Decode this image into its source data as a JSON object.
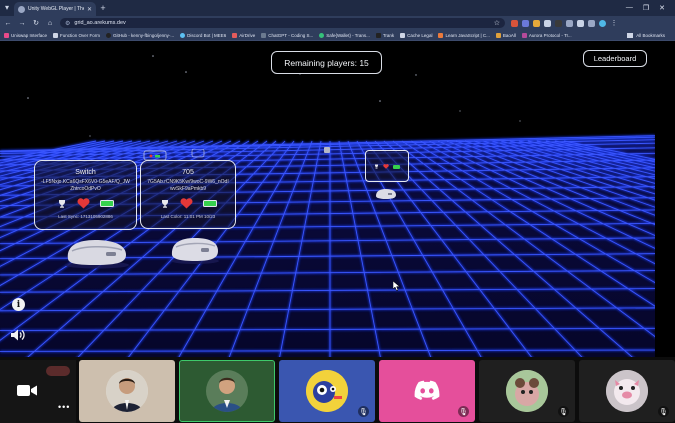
{
  "browser": {
    "tab_title": "Unity WebGL Player | The Li...",
    "url": "grid_ao.arekums.dev",
    "bookmarks": [
      "Uniswap Interface",
      "Function Over Form",
      "GitHub - kenny-fbingo/jenny-...",
      "Discord Bot | MEE6",
      "AirDrive",
      "ChatGPT - Coding S...",
      "Safe{Wallet} - Trans...",
      "Trank",
      "Cache Legal",
      "Learn JavaScript | C...",
      "BaoAll",
      "Aurora Protocol - Tr..."
    ],
    "all_bookmarks": "All Bookmarks"
  },
  "game": {
    "remaining_label": "Remaining players: 15",
    "leaderboard_label": "Leaderboard",
    "info_label": "i",
    "players": [
      {
        "name": "Switch",
        "address": "-LF5Nxjo.KCa6QsFX6V0-G5eAF/Q_JWZhtrcoOdPvO",
        "footer": "Last Sync: 1713105902886"
      },
      {
        "name": "705",
        "address": "7G5Ab.rCN9K5Kw/9woC-9W6_nOdIwvSkF9aPmkb9",
        "footer": "Last Color: 11:01 PM 10/23"
      },
      {
        "name": "",
        "address": "",
        "footer": ""
      }
    ]
  },
  "call": {
    "tiles": [
      {
        "kind": "person",
        "bg": "#cdbfae"
      },
      {
        "kind": "person",
        "bg": "#2d5a32",
        "active": true
      },
      {
        "kind": "avatar-robot",
        "bg": "#3a56b0"
      },
      {
        "kind": "discord",
        "bg": "#e54f9b"
      },
      {
        "kind": "avatar-animal",
        "bg": "#1f1f1f"
      },
      {
        "kind": "avatar-pig",
        "bg": "#1f1f1f"
      }
    ]
  }
}
